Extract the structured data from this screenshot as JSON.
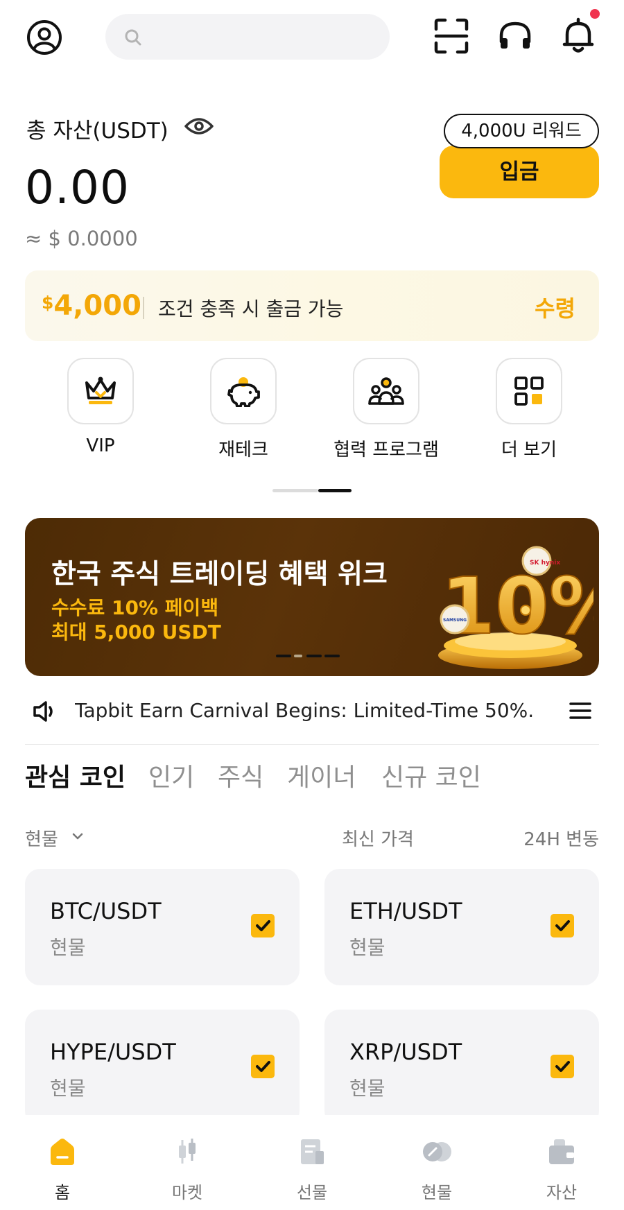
{
  "colors": {
    "accent": "#fbb80e",
    "accent_text": "#f3a707",
    "badge": "#f0344f",
    "banner_bg": "#4d2b05"
  },
  "header": {
    "profile_icon": "user-circle-icon",
    "search_placeholder": "",
    "scan_icon": "scan-icon",
    "support_icon": "headset-icon",
    "bell_icon": "bell-icon"
  },
  "balance": {
    "label": "총 자산(USDT)",
    "value": "0.00",
    "approx": "≈ $ 0.0000",
    "reward_pill": "4,000U 리워드",
    "deposit_label": "입금"
  },
  "promo": {
    "currency": "$",
    "amount": "4,000",
    "text": "조건 충족 시 출금 가능",
    "claim_label": "수령"
  },
  "quick_actions": [
    {
      "label": "VIP",
      "icon": "crown-icon"
    },
    {
      "label": "재테크",
      "icon": "piggy-bank-icon"
    },
    {
      "label": "협력 프로그램",
      "icon": "partners-icon"
    },
    {
      "label": "더 보기",
      "icon": "grid-icon"
    }
  ],
  "banner": {
    "title": "한국 주식 트레이딩 혜택 위크",
    "line1": "수수료 10% 페이백",
    "line2": "최대 5,000 USDT",
    "art_text": "10%",
    "logo_left": "SAMSUNG",
    "logo_right": "SK hynix"
  },
  "announcement": {
    "text": "Tapbit Earn Carnival Begins: Limited-Time 50%..."
  },
  "tabs": [
    "관심 코인",
    "인기",
    "주식",
    "게이너",
    "신규 코인"
  ],
  "list_header": {
    "market": "현물",
    "price": "최신 가격",
    "change": "24H 변동"
  },
  "coins": [
    {
      "pair": "BTC/USDT",
      "type": "현물",
      "checked": true
    },
    {
      "pair": "ETH/USDT",
      "type": "현물",
      "checked": true
    },
    {
      "pair": "HYPE/USDT",
      "type": "현물",
      "checked": true
    },
    {
      "pair": "XRP/USDT",
      "type": "현물",
      "checked": true
    }
  ],
  "bottom_nav": [
    {
      "label": "홈",
      "icon": "home-icon",
      "active": true
    },
    {
      "label": "마켓",
      "icon": "candlestick-icon",
      "active": false
    },
    {
      "label": "선물",
      "icon": "futures-icon",
      "active": false
    },
    {
      "label": "현물",
      "icon": "spot-icon",
      "active": false
    },
    {
      "label": "자산",
      "icon": "wallet-icon",
      "active": false
    }
  ]
}
